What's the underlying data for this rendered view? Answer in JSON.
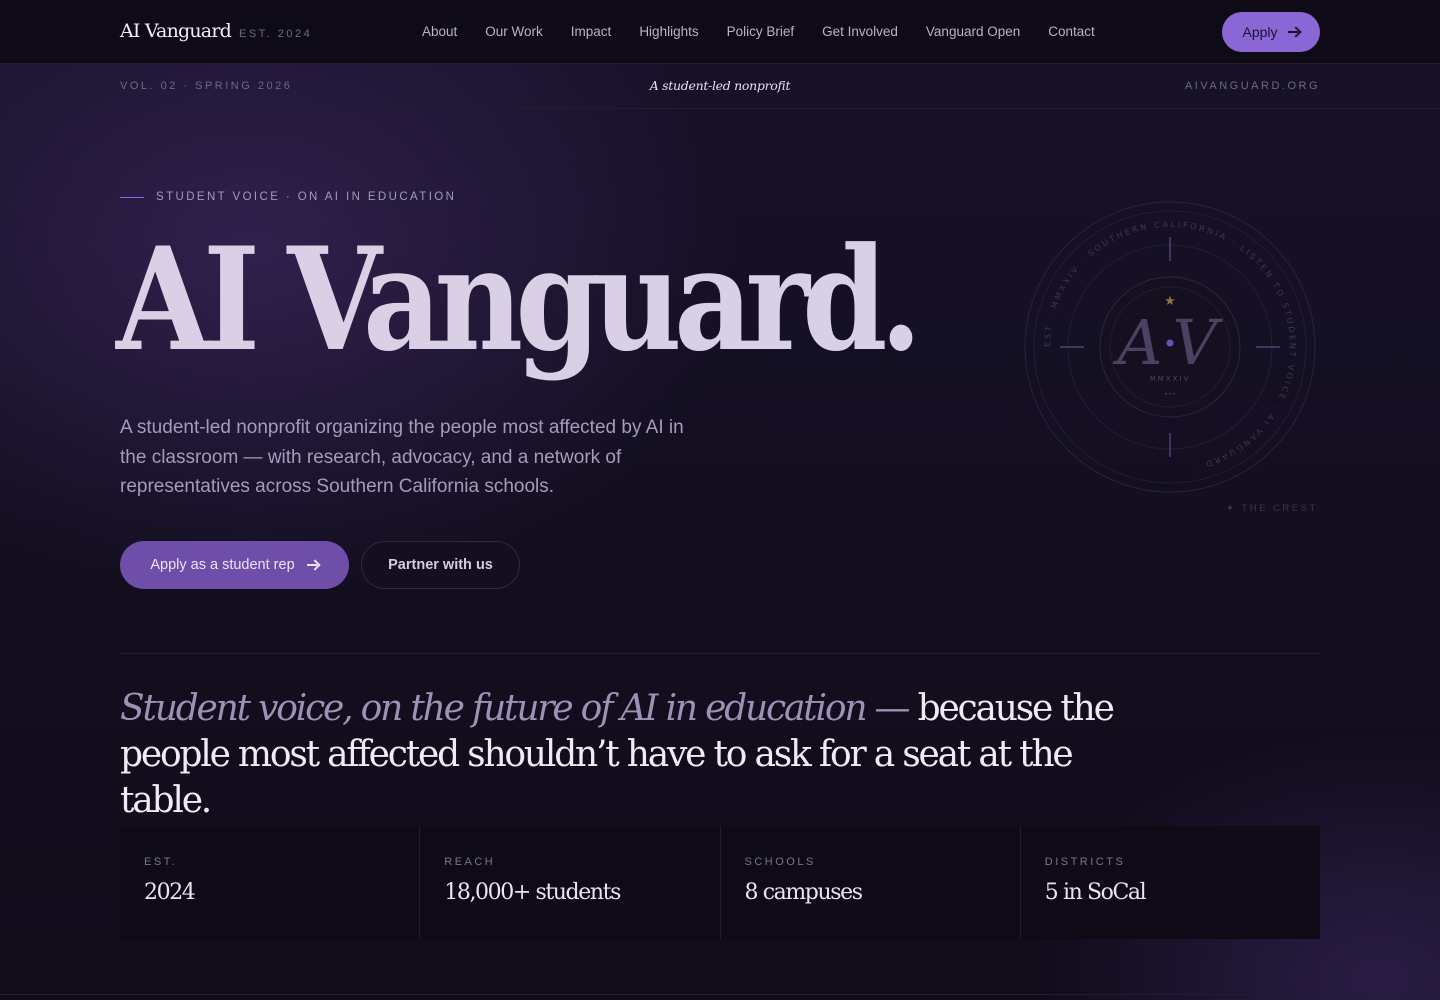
{
  "nav": {
    "brand": "AI Vanguard",
    "est": "EST. 2024",
    "links": [
      "About",
      "Our Work",
      "Impact",
      "Highlights",
      "Policy Brief",
      "Get Involved",
      "Vanguard Open",
      "Contact"
    ],
    "apply_label": "Apply"
  },
  "subbar": {
    "volume": "VOL. 02 · SPRING 2026",
    "tagline": "A student-led nonprofit",
    "site": "AIVANGUARD.ORG"
  },
  "hero": {
    "eyebrow": "STUDENT VOICE · ON AI IN EDUCATION",
    "title": "AI Vanguard.",
    "subtitle": "A student-led nonprofit organizing the people most affected by AI in the classroom — with research, advocacy, and a network of representatives across Southern California schools.",
    "primary_cta": "Apply as a student rep",
    "secondary_cta": "Partner with us"
  },
  "crest": {
    "monogram_left": "A",
    "monogram_right": "V",
    "year": "MMXXIV",
    "ring_text": "EST · MMXXIV · SOUTHERN CALIFORNIA · LISTEN TO STUDENT VOICE · AI VANGUARD ·",
    "caption": "✦ THE CREST"
  },
  "statement": {
    "italic": "Student voice, on the future of AI in education —",
    "plain": " because the people most affected shouldn’t have to ask for a seat at the table."
  },
  "stats": [
    {
      "label": "EST.",
      "value": "2024"
    },
    {
      "label": "REACH",
      "value": "18,000+ students"
    },
    {
      "label": "SCHOOLS",
      "value": "8 campuses"
    },
    {
      "label": "DISTRICTS",
      "value": "5 in SoCal"
    }
  ],
  "colors": {
    "accent": "#8b67d6",
    "accent_dark": "#6e4ea8",
    "background": "#110d1c",
    "star": "#a08a5a"
  }
}
